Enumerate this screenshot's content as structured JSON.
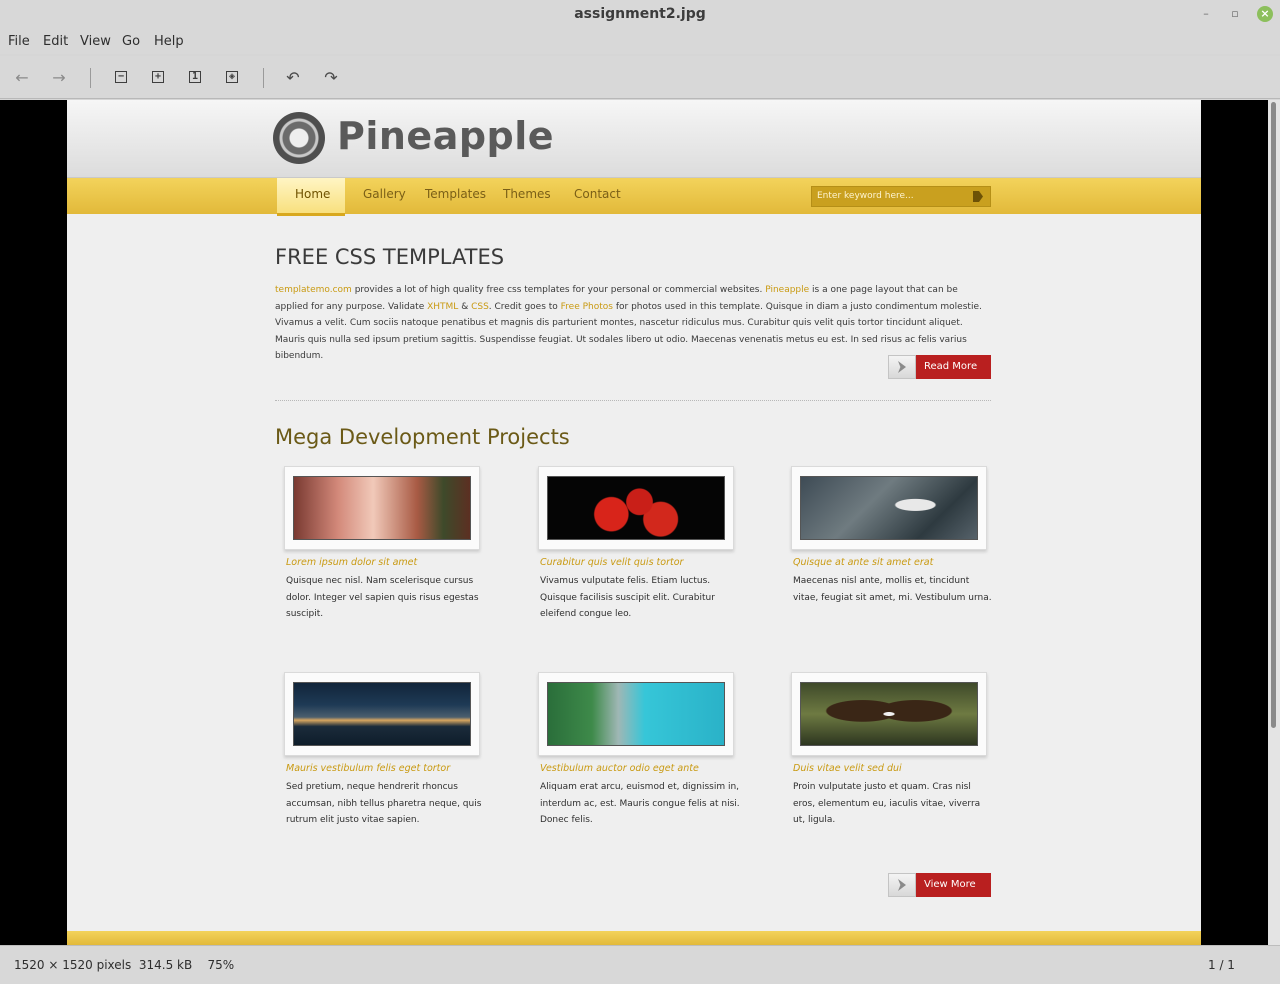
{
  "window": {
    "title": "assignment2.jpg",
    "minimize_glyph": "–",
    "maximize_glyph": "▫",
    "close_glyph": "×"
  },
  "menubar": {
    "items": [
      "File",
      "Edit",
      "View",
      "Go",
      "Help"
    ]
  },
  "toolbar": {
    "icons": [
      "back-arrow-icon",
      "forward-arrow-icon",
      "zoom-out-icon",
      "zoom-in-icon",
      "zoom-normal-icon",
      "zoom-fit-icon",
      "rotate-left-icon",
      "rotate-right-icon"
    ],
    "back_glyph": "←",
    "forward_glyph": "→",
    "zoom_out_glyph": "−",
    "zoom_in_glyph": "+",
    "zoom_normal_glyph": "1",
    "zoom_fit_glyph": "◈",
    "rotate_left_glyph": "↶",
    "rotate_right_glyph": "↷"
  },
  "website": {
    "logo_text": "Pineapple",
    "nav": [
      "Home",
      "Gallery",
      "Templates",
      "Themes",
      "Contact"
    ],
    "search_placeholder": "Enter keyword here...",
    "heading": "FREE CSS TEMPLATES",
    "intro": {
      "link1": "templatemo.com",
      "text1": " provides a lot of high quality free css templates for your personal or commercial websites. ",
      "link2": "Pineapple",
      "text2": " is a one page layout that can be applied for any purpose. Validate ",
      "link3": "XHTML",
      "text3": " & ",
      "link4": "CSS",
      "text4": ". Credit goes to ",
      "link5": "Free Photos",
      "text5": " for photos used in this template. Quisque in diam a justo condimentum molestie. Vivamus a velit. Cum sociis natoque penatibus et magnis dis parturient montes, nascetur ridiculus mus. Curabitur quis velit quis tortor tincidunt aliquet. Mauris quis nulla sed ipsum pretium sagittis. Suspendisse feugiat. Ut sodales libero ut odio. Maecenas venenatis metus eu est. In sed risus ac felis varius bibendum."
    },
    "read_more": "Read More",
    "projects_heading": "Mega Development Projects",
    "projects": [
      {
        "title": "Lorem ipsum dolor sit amet",
        "text": "Quisque nec nisl. Nam scelerisque cursus dolor. Integer vel sapien quis risus egestas suscipit."
      },
      {
        "title": "Curabitur quis velit quis tortor",
        "text": "Vivamus vulputate felis. Etiam luctus. Quisque facilisis suscipit elit. Curabitur eleifend congue leo."
      },
      {
        "title": "Quisque at ante sit amet erat",
        "text": "Maecenas nisl ante, mollis et, tincidunt vitae, feugiat sit amet, mi. Vestibulum urna."
      },
      {
        "title": "Mauris vestibulum felis eget tortor",
        "text": "Sed pretium, neque hendrerit rhoncus accumsan, nibh tellus pharetra neque, quis rutrum elit justo vitae sapien."
      },
      {
        "title": "Vestibulum auctor odio eget ante",
        "text": "Aliquam erat arcu, euismod et, dignissim in, interdum ac, est. Mauris congue felis at nisi. Donec felis."
      },
      {
        "title": "Duis vitae velit sed dui",
        "text": "Proin vulputate justo et quam. Cras nisl eros, elementum eu, iaculis vitae, viverra ut, ligula."
      }
    ],
    "view_more": "View More"
  },
  "status": {
    "dimensions": "1520 × 1520 pixels",
    "filesize": "314.5 kB",
    "zoom": "75%",
    "page": "1 / 1"
  },
  "colors": {
    "nav_yellow": "#e9c444",
    "button_red": "#b91f1f",
    "link_gold": "#c99a12",
    "heading_olive": "#6b5a17"
  }
}
